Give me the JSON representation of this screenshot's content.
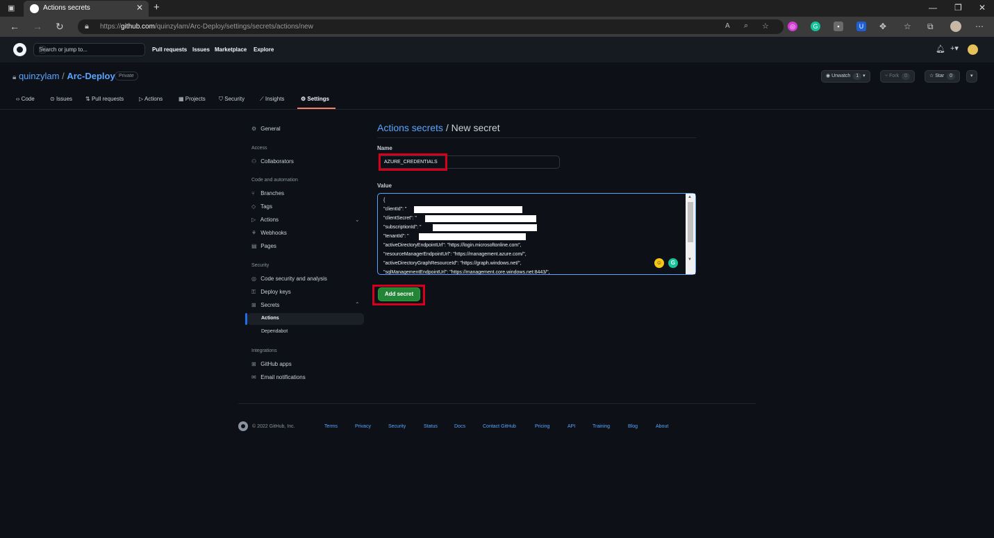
{
  "browser": {
    "tab_title": "Actions secrets",
    "tab_close": "✕",
    "new_tab": "+",
    "win_min": "—",
    "win_restore": "❐",
    "win_close": "✕",
    "url_prefix": "https://",
    "url_host": "github.com",
    "url_path": "/quinzylam/Arc-Deploy/settings/secrets/actions/new"
  },
  "gh_header": {
    "search_placeholder": "Search or jump to...",
    "search_key": "/",
    "nav": [
      "Pull requests",
      "Issues",
      "Marketplace",
      "Explore"
    ]
  },
  "repo": {
    "owner": "quinzylam",
    "sep": " / ",
    "name": "Arc-Deploy",
    "visibility": "Private",
    "unwatch_label": "Unwatch",
    "unwatch_count": "1",
    "fork_label": "Fork",
    "fork_count": "0",
    "star_label": "Star",
    "star_count": "0"
  },
  "repo_tabs": [
    "Code",
    "Issues",
    "Pull requests",
    "Actions",
    "Projects",
    "Security",
    "Insights",
    "Settings"
  ],
  "sidebar": {
    "general": "General",
    "access_head": "Access",
    "collaborators": "Collaborators",
    "code_head": "Code and automation",
    "branches": "Branches",
    "tags": "Tags",
    "actions": "Actions",
    "webhooks": "Webhooks",
    "pages": "Pages",
    "security_head": "Security",
    "code_security": "Code security and analysis",
    "deploy_keys": "Deploy keys",
    "secrets": "Secrets",
    "secrets_actions": "Actions",
    "secrets_dependabot": "Dependabot",
    "integrations_head": "Integrations",
    "github_apps": "GitHub apps",
    "email_notifications": "Email notifications"
  },
  "main": {
    "heading_link": "Actions secrets",
    "heading_rest": " / New secret",
    "name_label": "Name",
    "name_value": "AZURE_CREDENTIALS",
    "value_label": "Value",
    "value_lines": [
      "{",
      "  \"clientId\": \"",
      "  \"clientSecret\": \"",
      "  \"subscriptionId\": \"",
      "  \"tenantId\": \"",
      "  \"activeDirectoryEndpointUrl\": \"https://login.microsoftonline.com\",",
      "  \"resourceManagerEndpointUrl\": \"https://management.azure.com/\",",
      "  \"activeDirectoryGraphResourceId\": \"https://graph.windows.net/\",",
      "  \"sqlManagementEndpointUrl\": \"https://management.core.windows.net:8443/\","
    ],
    "add_button": "Add secret"
  },
  "footer": {
    "copyright": "© 2022 GitHub, Inc.",
    "links": [
      "Terms",
      "Privacy",
      "Security",
      "Status",
      "Docs",
      "Contact GitHub",
      "Pricing",
      "API",
      "Training",
      "Blog",
      "About"
    ]
  },
  "colors": {
    "bg": "#0d1117",
    "link": "#58a6ff",
    "primary_button": "#238636",
    "highlight": "#d6001c",
    "selected_bar": "#1f6feb"
  }
}
